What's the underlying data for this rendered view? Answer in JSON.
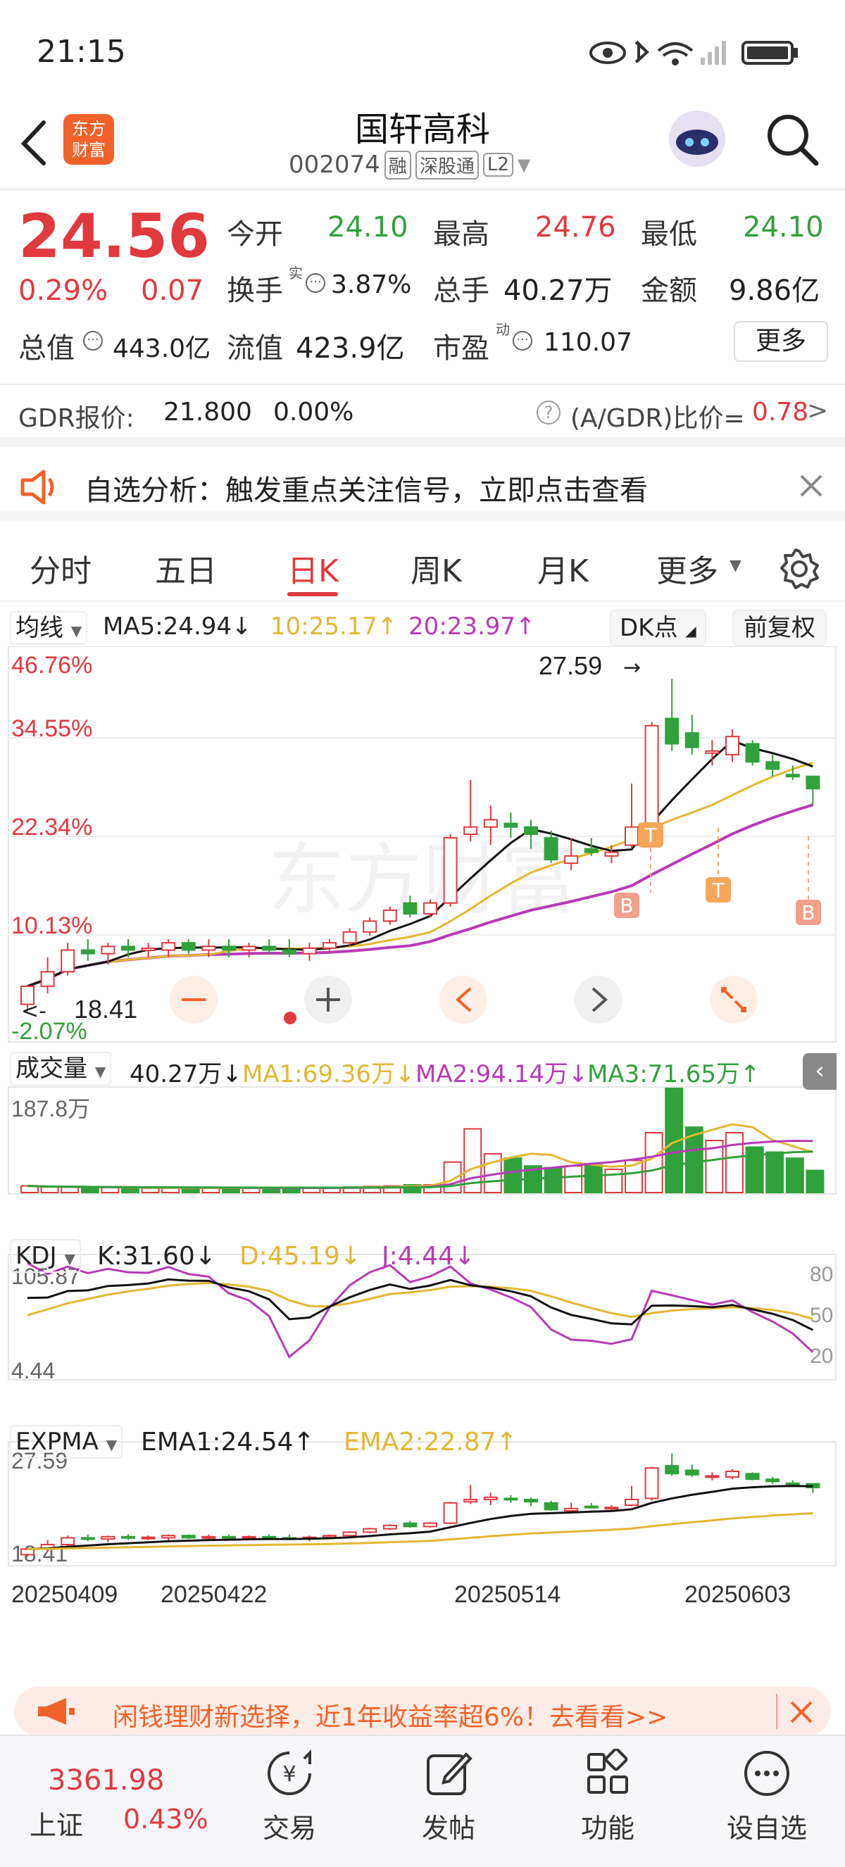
{
  "status_bar": {
    "time": "21:15"
  },
  "header": {
    "brand_logo_text": "东方\n财富",
    "stock_name": "国轩高科",
    "stock_code": "002074",
    "tags": [
      "融",
      "深股通",
      "L2"
    ]
  },
  "quote": {
    "price": "24.56",
    "change_pct": "0.29%",
    "change_amt": "0.07",
    "open_label": "今开",
    "open": "24.10",
    "high_label": "最高",
    "high": "24.76",
    "low_label": "最低",
    "low": "24.10",
    "turnover_label": "换手",
    "turnover_sup": "实",
    "turnover": "3.87%",
    "volume_label": "总手",
    "volume": "40.27万",
    "amount_label": "金额",
    "amount": "9.86亿",
    "mktcap_label": "总值",
    "mktcap": "443.0亿",
    "float_label": "流值",
    "float": "423.9亿",
    "pe_label": "市盈",
    "pe_sup": "动",
    "pe": "110.07",
    "more_button": "更多"
  },
  "gdr": {
    "label": "GDR报价:",
    "price": "21.800",
    "pct": "0.00%",
    "ratio_label": "(A/GDR)比价=",
    "ratio": "0.78",
    "arrow": ">"
  },
  "notice": {
    "text": "自选分析：触发重点关注信号，立即点击查看"
  },
  "tabs": {
    "items": [
      "分时",
      "五日",
      "日K",
      "周K",
      "月K",
      "更多"
    ],
    "active": "日K"
  },
  "chart_header": {
    "indicator_select": "均线",
    "ma5": "MA5:24.94↓",
    "ma10": "10:25.17↑",
    "ma20": "20:23.97↑",
    "dk_button": "DK点",
    "adjust_button": "前复权"
  },
  "price_axis": {
    "labels": [
      "46.76%",
      "34.55%",
      "22.34%",
      "10.13%",
      "-2.07%"
    ],
    "high_marker": "27.59",
    "low_marker": "18.41"
  },
  "volume_header": {
    "select": "成交量",
    "value": "40.27万↓",
    "ma1": "MA1:69.36万↓",
    "ma2": "MA2:94.14万↓",
    "ma3": "MA3:71.65万↑",
    "axis_max": "187.8万"
  },
  "kdj_header": {
    "select": "KDJ",
    "k": "K:31.60↓",
    "d": "D:45.19↓",
    "j": "J:4.44↓",
    "axis_max": "105.87",
    "axis_min": "4.44",
    "levels": [
      "80",
      "50",
      "20"
    ]
  },
  "expma_header": {
    "select": "EXPMA",
    "ema1": "EMA1:24.54↑",
    "ema2": "EMA2:22.87↑",
    "axis_max": "27.59",
    "axis_min": "18.41"
  },
  "date_axis": [
    "20250409",
    "20250422",
    "20250514",
    "20250603"
  ],
  "signals": [
    "B",
    "T",
    "T",
    "B"
  ],
  "ad_banner": {
    "text": "闲钱理财新选择，近1年收益率超6%！去看看>>"
  },
  "bottom_nav": {
    "index_value": "3361.98",
    "index_name": "上证",
    "index_pct": "0.43%",
    "items": [
      "交易",
      "发帖",
      "功能",
      "设自选"
    ]
  },
  "colors": {
    "up": "#e0393e",
    "down": "#31a13c",
    "ma5": "#111111",
    "ma10": "#e2b733",
    "ma20": "#b73bb7",
    "accent": "#f0622a"
  },
  "chart_data": {
    "type": "candlestick",
    "title": "国轩高科 日K",
    "ylim": [
      18.41,
      27.59
    ],
    "candles": [
      {
        "o": 18.6,
        "h": 19.0,
        "l": 18.41,
        "c": 19.1
      },
      {
        "o": 19.1,
        "h": 19.9,
        "l": 18.9,
        "c": 19.5
      },
      {
        "o": 19.5,
        "h": 20.3,
        "l": 19.4,
        "c": 20.1
      },
      {
        "o": 20.1,
        "h": 20.4,
        "l": 19.8,
        "c": 20.0
      },
      {
        "o": 20.0,
        "h": 20.3,
        "l": 19.7,
        "c": 20.2
      },
      {
        "o": 20.2,
        "h": 20.4,
        "l": 19.9,
        "c": 20.1
      },
      {
        "o": 20.1,
        "h": 20.3,
        "l": 19.9,
        "c": 20.15
      },
      {
        "o": 20.1,
        "h": 20.4,
        "l": 19.9,
        "c": 20.3
      },
      {
        "o": 20.3,
        "h": 20.4,
        "l": 20.0,
        "c": 20.1
      },
      {
        "o": 20.1,
        "h": 20.4,
        "l": 19.9,
        "c": 20.2
      },
      {
        "o": 20.2,
        "h": 20.4,
        "l": 19.9,
        "c": 20.1
      },
      {
        "o": 20.1,
        "h": 20.3,
        "l": 19.9,
        "c": 20.2
      },
      {
        "o": 20.2,
        "h": 20.4,
        "l": 20.0,
        "c": 20.1
      },
      {
        "o": 20.1,
        "h": 20.4,
        "l": 19.9,
        "c": 20.0
      },
      {
        "o": 20.0,
        "h": 20.3,
        "l": 19.8,
        "c": 20.15
      },
      {
        "o": 20.15,
        "h": 20.4,
        "l": 20.0,
        "c": 20.3
      },
      {
        "o": 20.3,
        "h": 20.7,
        "l": 20.2,
        "c": 20.6
      },
      {
        "o": 20.6,
        "h": 21.0,
        "l": 20.5,
        "c": 20.9
      },
      {
        "o": 20.9,
        "h": 21.3,
        "l": 20.8,
        "c": 21.2
      },
      {
        "o": 21.4,
        "h": 21.6,
        "l": 21.0,
        "c": 21.1
      },
      {
        "o": 21.1,
        "h": 21.5,
        "l": 21.0,
        "c": 21.4
      },
      {
        "o": 21.4,
        "h": 23.3,
        "l": 21.3,
        "c": 23.2
      },
      {
        "o": 23.3,
        "h": 24.8,
        "l": 23.1,
        "c": 23.5
      },
      {
        "o": 23.5,
        "h": 24.1,
        "l": 23.0,
        "c": 23.7
      },
      {
        "o": 23.6,
        "h": 23.9,
        "l": 23.2,
        "c": 23.5
      },
      {
        "o": 23.5,
        "h": 23.7,
        "l": 22.9,
        "c": 23.3
      },
      {
        "o": 23.2,
        "h": 23.4,
        "l": 22.5,
        "c": 22.6
      },
      {
        "o": 22.5,
        "h": 23.2,
        "l": 22.3,
        "c": 22.7
      },
      {
        "o": 22.9,
        "h": 23.2,
        "l": 22.7,
        "c": 22.8
      },
      {
        "o": 22.7,
        "h": 23.0,
        "l": 22.5,
        "c": 22.8
      },
      {
        "o": 23.0,
        "h": 24.7,
        "l": 22.9,
        "c": 23.5
      },
      {
        "o": 23.6,
        "h": 26.4,
        "l": 23.4,
        "c": 26.3
      },
      {
        "o": 26.5,
        "h": 27.59,
        "l": 25.6,
        "c": 25.8
      },
      {
        "o": 26.1,
        "h": 26.6,
        "l": 25.5,
        "c": 25.7
      },
      {
        "o": 25.6,
        "h": 25.9,
        "l": 25.2,
        "c": 25.6
      },
      {
        "o": 25.5,
        "h": 26.2,
        "l": 25.3,
        "c": 26.0
      },
      {
        "o": 25.8,
        "h": 25.9,
        "l": 25.2,
        "c": 25.3
      },
      {
        "o": 25.3,
        "h": 25.5,
        "l": 24.9,
        "c": 25.1
      },
      {
        "o": 24.95,
        "h": 25.2,
        "l": 24.8,
        "c": 24.9
      },
      {
        "o": 24.9,
        "h": 24.8,
        "l": 24.1,
        "c": 24.56
      }
    ],
    "volume": [
      12,
      10,
      10,
      9,
      9,
      9,
      8,
      8,
      8,
      9,
      8,
      8,
      8,
      8,
      9,
      9,
      10,
      11,
      12,
      14,
      14,
      55,
      115,
      70,
      62,
      48,
      45,
      48,
      50,
      42,
      58,
      108,
      188,
      118,
      94,
      108,
      82,
      73,
      62,
      40
    ]
  }
}
